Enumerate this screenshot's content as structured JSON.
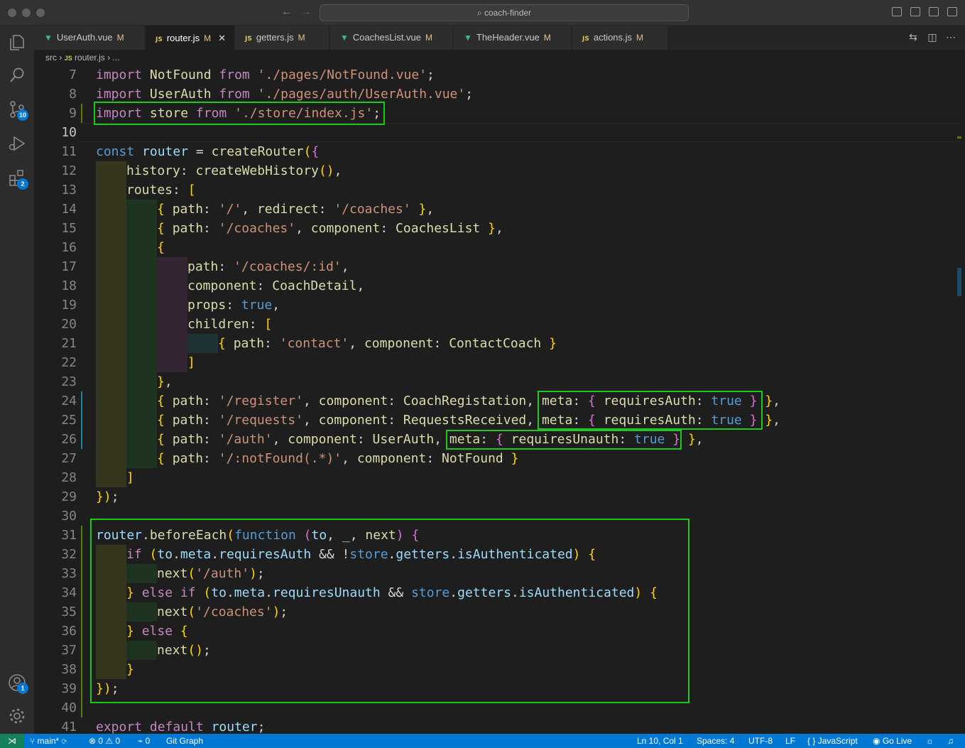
{
  "window": {
    "title": "coach-finder"
  },
  "activity_bar": {
    "scm_badge": "10",
    "extensions_badge": "2",
    "accounts_badge": "1"
  },
  "tabs": [
    {
      "label": "UserAuth.vue",
      "status": "M",
      "kind": "vue"
    },
    {
      "label": "router.js",
      "status": "M",
      "kind": "js",
      "active": true
    },
    {
      "label": "getters.js",
      "status": "M",
      "kind": "js"
    },
    {
      "label": "CoachesList.vue",
      "status": "M",
      "kind": "vue"
    },
    {
      "label": "TheHeader.vue",
      "status": "M",
      "kind": "vue"
    },
    {
      "label": "actions.js",
      "status": "M",
      "kind": "js"
    }
  ],
  "breadcrumb": {
    "folder": "src",
    "file": "router.js",
    "more": "..."
  },
  "js_badge": "JS",
  "editor": {
    "lines": [
      {
        "n": "7",
        "text": "import NotFound from './pages/NotFound.vue';"
      },
      {
        "n": "8",
        "text": "import UserAuth from './pages/auth/UserAuth.vue';"
      },
      {
        "n": "9",
        "text": "import store from './store/index.js';"
      },
      {
        "n": "10",
        "text": ""
      },
      {
        "n": "11",
        "text": "const router = createRouter({"
      },
      {
        "n": "12",
        "text": "  history: createWebHistory(),"
      },
      {
        "n": "13",
        "text": "  routes: ["
      },
      {
        "n": "14",
        "text": "    { path: '/', redirect: '/coaches' },"
      },
      {
        "n": "15",
        "text": "    { path: '/coaches', component: CoachesList },"
      },
      {
        "n": "16",
        "text": "    {"
      },
      {
        "n": "17",
        "text": "      path: '/coaches/:id',"
      },
      {
        "n": "18",
        "text": "      component: CoachDetail,"
      },
      {
        "n": "19",
        "text": "      props: true,"
      },
      {
        "n": "20",
        "text": "      children: ["
      },
      {
        "n": "21",
        "text": "        { path: 'contact', component: ContactCoach }"
      },
      {
        "n": "22",
        "text": "      ]"
      },
      {
        "n": "23",
        "text": "    },"
      },
      {
        "n": "24",
        "text": "    { path: '/register', component: CoachRegistation, meta: { requiresAuth: true } },"
      },
      {
        "n": "25",
        "text": "    { path: '/requests', component: RequestsReceived, meta: { requiresAuth: true } },"
      },
      {
        "n": "26",
        "text": "    { path: '/auth', component: UserAuth, meta: { requiresUnauth: true } },"
      },
      {
        "n": "27",
        "text": "    { path: '/:notFound(.*)', component: NotFound }"
      },
      {
        "n": "28",
        "text": "  ]"
      },
      {
        "n": "29",
        "text": "});"
      },
      {
        "n": "30",
        "text": ""
      },
      {
        "n": "31",
        "text": "router.beforeEach(function (to, _, next) {"
      },
      {
        "n": "32",
        "text": "  if (to.meta.requiresAuth && !store.getters.isAuthenticated) {"
      },
      {
        "n": "33",
        "text": "    next('/auth');"
      },
      {
        "n": "34",
        "text": "  } else if (to.meta.requiresUnauth && store.getters.isAuthenticated) {"
      },
      {
        "n": "35",
        "text": "    next('/coaches');"
      },
      {
        "n": "36",
        "text": "  } else {"
      },
      {
        "n": "37",
        "text": "    next();"
      },
      {
        "n": "38",
        "text": "  }"
      },
      {
        "n": "39",
        "text": "});"
      },
      {
        "n": "40",
        "text": ""
      },
      {
        "n": "41",
        "text": "export default router;"
      }
    ]
  },
  "status_bar": {
    "branch": "main*",
    "errors": "0",
    "warnings": "0",
    "ports": "0",
    "git_graph": "Git Graph",
    "cursor": "Ln 10, Col 1",
    "spaces": "Spaces: 4",
    "encoding": "UTF-8",
    "eol": "LF",
    "language": "JavaScript",
    "go_live": "Go Live"
  },
  "colors": {
    "accent": "#0078d4",
    "highlight_box": "#1cc91c",
    "remote": "#16825d"
  }
}
